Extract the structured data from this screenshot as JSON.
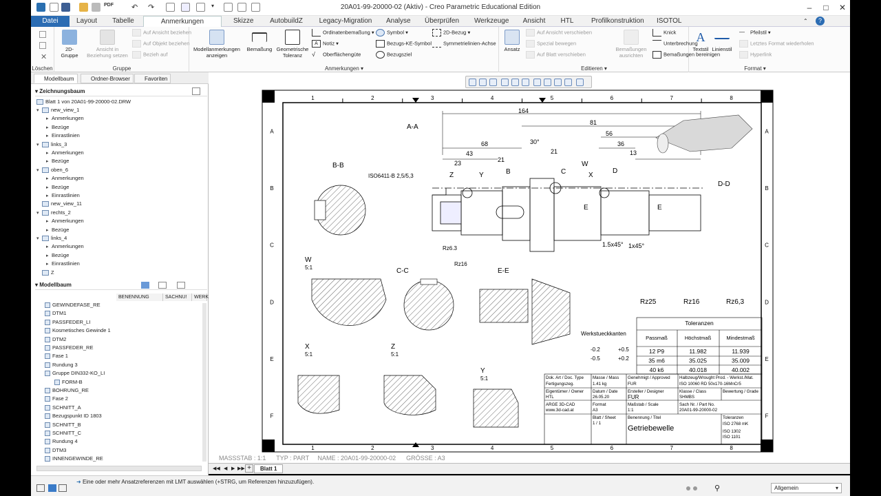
{
  "window": {
    "title": "20A01-99-20000-02 (Aktiv) - Creo Parametric Educational Edition",
    "minimize": "–",
    "maximize": "□",
    "close": "✕"
  },
  "tabs": [
    "Datei",
    "Layout",
    "Tabelle",
    "Anmerkungen erstellen",
    "Skizze",
    "AutobuildZ",
    "Legacy-Migration",
    "Analyse",
    "Überprüfen",
    "Werkzeuge",
    "Ansicht",
    "HTL",
    "Profilkonstruktion",
    "ISOTOL"
  ],
  "active_tab": "Anmerkungen erstellen",
  "ribbon": {
    "loeschen": {
      "label": "Löschen"
    },
    "gruppe": {
      "label": "Gruppe",
      "gruppe_2d": "2D-\nGruppe",
      "ansicht_in": "Ansicht in\nBeziehung setzen",
      "auf_ansicht": "Auf Ansicht beziehen",
      "auf_objekt": "Auf Objekt beziehen",
      "bezieh_auf": "Bezieh auf"
    },
    "anmerkungen": {
      "label": "Anmerkungen",
      "modellanm": "Modellanmerkungen\nanzeigen",
      "bemassung": "Bemaßung",
      "geom_tol": "Geometrische\nToleranz",
      "ordinaten": "Ordinatenbemaßung",
      "notiz": "Notiz",
      "oberflaeche": "Oberflächengüte",
      "symbol": "Symbol",
      "bezugs_ke": "Bezugs-KE-Symbol",
      "bezugsziel": "Bezugsziel",
      "bezug_2d": "2D-Bezug",
      "symm_achse": "Symmetrielinien-Achse"
    },
    "editieren": {
      "label": "Editieren",
      "ansatz": "Ansatz",
      "auf_ansicht_v": "Auf Ansicht verschieben",
      "spezial": "Spezial bewegen",
      "auf_blatt": "Auf Blatt verschieben",
      "bem_ausrichten": "Bemaßungen\nausrichten",
      "knick": "Knick",
      "unterbrechung": "Unterbrechung",
      "bem_bereinigen": "Bemaßungen bereinigen"
    },
    "format": {
      "label": "Format",
      "textstil": "Textstil",
      "linienstil": "Linienstil",
      "pfeilstil": "Pfeilstil",
      "letztes_format": "Letztes Format wiederholen",
      "hyperlink": "Hyperlink"
    }
  },
  "left_panel": {
    "tabs": [
      "Modellbaum",
      "Ordner-Browser",
      "Favoriten"
    ],
    "zeichnungsbaum": "Zeichnungsbaum",
    "blatt": "Blatt 1 von 20A01-99-20000-02.DRW",
    "views": [
      {
        "name": "new_view_1",
        "children": [
          "Anmerkungen",
          "Bezüge",
          "Einrastlinien"
        ]
      },
      {
        "name": "links_3",
        "children": [
          "Anmerkungen",
          "Bezüge"
        ]
      },
      {
        "name": "oben_6",
        "children": [
          "Anmerkungen",
          "Bezüge",
          "Einrastlinien"
        ]
      },
      {
        "name": "new_view_11",
        "children": []
      },
      {
        "name": "rechts_2",
        "children": [
          "Anmerkungen",
          "Bezüge"
        ]
      },
      {
        "name": "links_4",
        "children": [
          "Anmerkungen",
          "Bezüge",
          "Einrastlinien"
        ]
      },
      {
        "name": "Z",
        "children": []
      }
    ],
    "modellbaum": "Modellbaum",
    "columns": [
      "BENENNUNG",
      "SACHNU!",
      "WERKS"
    ],
    "model_items": [
      "GEWINDEFASE_RE",
      "DTM1",
      "PASSFEDER_LI",
      "Kosmetisches Gewinde 1",
      "DTM2",
      "PASSFEDER_RE",
      "Fase 1",
      "Rundung 3",
      "Gruppe DIN332-KO_LI",
      "FORM-B",
      "BOHRUNG_RE",
      "Fase 2",
      "SCHNITT_A",
      "Bezugspunkt ID 1803",
      "SCHNITT_B",
      "SCHNITT_C",
      "Rundung 4",
      "DTM3",
      "INNENGEWINDE_RE"
    ]
  },
  "drawing": {
    "zones_top": [
      "1",
      "2",
      "3",
      "4",
      "5",
      "6",
      "7",
      "8"
    ],
    "zones_side": [
      "A",
      "B",
      "C",
      "D",
      "E",
      "F"
    ],
    "section_aa": "A-A",
    "section_bb": "B-B",
    "section_cc": "C-C",
    "section_dd": "D-D",
    "section_ee": "E-E",
    "detail_w": "W",
    "detail_x": "X",
    "detail_y": "Y",
    "detail_z": "Z",
    "scale_51": "5:1",
    "dims": [
      "164",
      "81",
      "56",
      "68",
      "36",
      "43",
      "21",
      "21",
      "23",
      "13",
      "30°",
      "15",
      "6",
      "12 P9",
      "1.5x45°",
      "1x45°",
      "Rz6.3",
      "Rz16",
      "Rz25",
      "Ø40 k6",
      "Ø35 m6",
      "ISO6411-B 2,5/5,3"
    ],
    "surface": [
      "Rz25",
      "Rz16",
      "Rz6,3"
    ],
    "tol_title": "Toleranzen\nTolerances",
    "tol_headers": [
      "Passmaß\nBASIC SIZE",
      "Höchstmaß\nMAXIMUM",
      "Mindestmaß\nMINIMUM"
    ],
    "tol_rows": [
      [
        "12 P9",
        "11.982",
        "11.939"
      ],
      [
        "35 m6",
        "35.025",
        "35.009"
      ],
      [
        "40 k6",
        "40.018",
        "40.002"
      ]
    ],
    "werkstueck": "Werkstueckkanten\nnach ISO13715",
    "werk_vals": [
      "-0.2",
      "+0.5",
      "-0.5",
      "+0.2"
    ],
    "tb": {
      "dok_art": "Dok. Art / Doc. Type",
      "dok_art_v": "Fertigungszeg.",
      "masse": "Masse / Mass",
      "masse_v": "1.41 kg",
      "genehmigt": "Genehmigt / Approved",
      "genehmigt_v": "FUR",
      "halbzeug": "Halbzeug/Wrought Prod. - Werkst./Mat.",
      "halbzeug_v": "ISO 10060 RD 50x170-16MnCr5",
      "eigentuemer": "Eigentümer / Owner",
      "eigentuemer_v": "HTL",
      "datum": "Datum / Date",
      "datum_v": "26.05.20",
      "ersteller": "Ersteller / Designer",
      "ersteller_v": "FUR",
      "klasse": "Klasse / Class",
      "klasse_v": "SHMBS",
      "bewertung": "Bewertung / Grade",
      "firma": "ARGE 3D-CAD",
      "web": "www.3d-cad.at",
      "format": "Format",
      "format_v": "A3",
      "massstab": "Maßstab / Scale",
      "massstab_v": "1:1",
      "sachnr": "Sach Nr. / Part No.",
      "sachnr_v": "20A01-99-20000-02",
      "blatt": "Blatt / Sheet",
      "blatt_v": "1 / 1",
      "benennung": "Benennung / Titel",
      "benennung_v": "Getriebewelle",
      "toleranzen": "Toleranzen",
      "tol_v1": "ISO 2768 mK",
      "tol_v2": "ISO 1302",
      "tol_v3": "ISO 1101"
    }
  },
  "status_line": "MASSSTAB : 1:1      TYP : PART     NAME : 20A01-99-20000-02      GRÖSSE : A3",
  "sheet_tab": "Blatt 1",
  "message": "Eine oder mehr Ansatzreferenzen mit LMT auswählen (+STRG, um Referenzen hinzuzufügen).",
  "filter_value": "Allgemein",
  "colors": {
    "file_tab": "#2b6cb3",
    "accent": "#1e5aa8"
  }
}
